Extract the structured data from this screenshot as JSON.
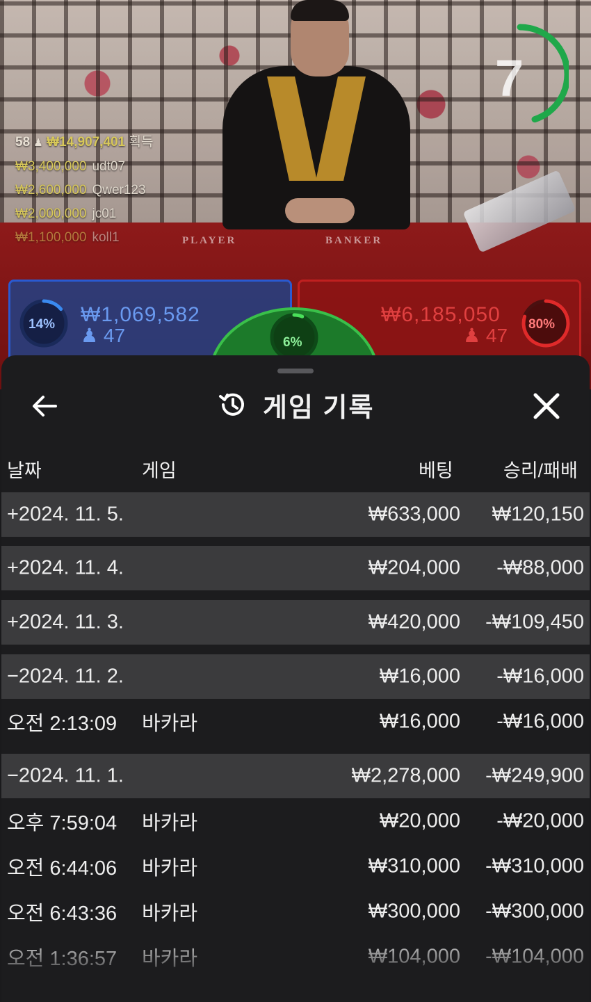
{
  "stream": {
    "timer": "7",
    "timer_progress": 0.45,
    "felt": {
      "player": "PLAYER",
      "banker": "BANKER"
    },
    "winners": {
      "count": "58",
      "total": "₩14,907,401",
      "gain_label": "획득",
      "list": [
        {
          "amount": "₩3,400,000",
          "name": "udt07"
        },
        {
          "amount": "₩2,600,000",
          "name": "Qwer123"
        },
        {
          "amount": "₩2,000,000",
          "name": "jc01"
        },
        {
          "amount": "₩1,100,000",
          "name": "koll1"
        }
      ]
    },
    "player_panel": {
      "percent": "14%",
      "percent_value": 0.14,
      "amount": "₩1,069,582",
      "count": "47"
    },
    "banker_panel": {
      "percent": "80%",
      "percent_value": 0.8,
      "amount": "₩6,185,050",
      "count": "47"
    },
    "tie_panel": {
      "percent": "6%",
      "percent_value": 0.06
    },
    "colors": {
      "player": "#2a5ad0",
      "banker": "#c02020",
      "tie": "#3ac04a",
      "gold": "#d8c85a"
    }
  },
  "sheet": {
    "title": "게임 기록",
    "icons": {
      "back": "arrow-left-icon",
      "history": "history-icon",
      "close": "close-icon"
    },
    "columns": {
      "date": "날짜",
      "game": "게임",
      "bet": "베팅",
      "result": "승리/패배"
    },
    "rows": [
      {
        "type": "date",
        "date": "+2024. 11. 5.",
        "game": "",
        "bet": "₩633,000",
        "result": "₩120,150"
      },
      {
        "type": "date",
        "date": "+2024. 11. 4.",
        "game": "",
        "bet": "₩204,000",
        "result": "-₩88,000"
      },
      {
        "type": "date",
        "date": "+2024. 11. 3.",
        "game": "",
        "bet": "₩420,000",
        "result": "-₩109,450"
      },
      {
        "type": "date",
        "date": "−2024. 11. 2.",
        "game": "",
        "bet": "₩16,000",
        "result": "-₩16,000"
      },
      {
        "type": "game",
        "date": "오전 2:13:09",
        "game": "바카라",
        "bet": "₩16,000",
        "result": "-₩16,000"
      },
      {
        "type": "date",
        "date": "−2024. 11. 1.",
        "game": "",
        "bet": "₩2,278,000",
        "result": "-₩249,900"
      },
      {
        "type": "game",
        "date": "오후 7:59:04",
        "game": "바카라",
        "bet": "₩20,000",
        "result": "-₩20,000"
      },
      {
        "type": "game",
        "date": "오전 6:44:06",
        "game": "바카라",
        "bet": "₩310,000",
        "result": "-₩310,000"
      },
      {
        "type": "game",
        "date": "오전 6:43:36",
        "game": "바카라",
        "bet": "₩300,000",
        "result": "-₩300,000"
      },
      {
        "type": "game",
        "date": "오전 1:36:57",
        "game": "바카라",
        "bet": "₩104,000",
        "result": "-₩104,000"
      }
    ]
  }
}
